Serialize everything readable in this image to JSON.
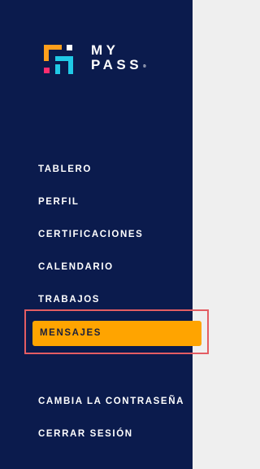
{
  "brand": {
    "line1": "MY",
    "line2": "PASS",
    "reg": "®"
  },
  "nav": {
    "items": [
      {
        "label": "TABLERO"
      },
      {
        "label": "PERFIL"
      },
      {
        "label": "CERTIFICACIONES"
      },
      {
        "label": "CALENDARIO"
      },
      {
        "label": "TRABAJOS"
      },
      {
        "label": "MENSAJES",
        "active": true
      },
      {
        "label": "CAMBIA LA CONTRASEÑA"
      },
      {
        "label": "CERRAR SESIÓN"
      }
    ]
  },
  "colors": {
    "sidebar_bg": "#0b1b4d",
    "active_bg": "#ffa400",
    "highlight_border": "#e35d63",
    "page_bg": "#efefef"
  }
}
